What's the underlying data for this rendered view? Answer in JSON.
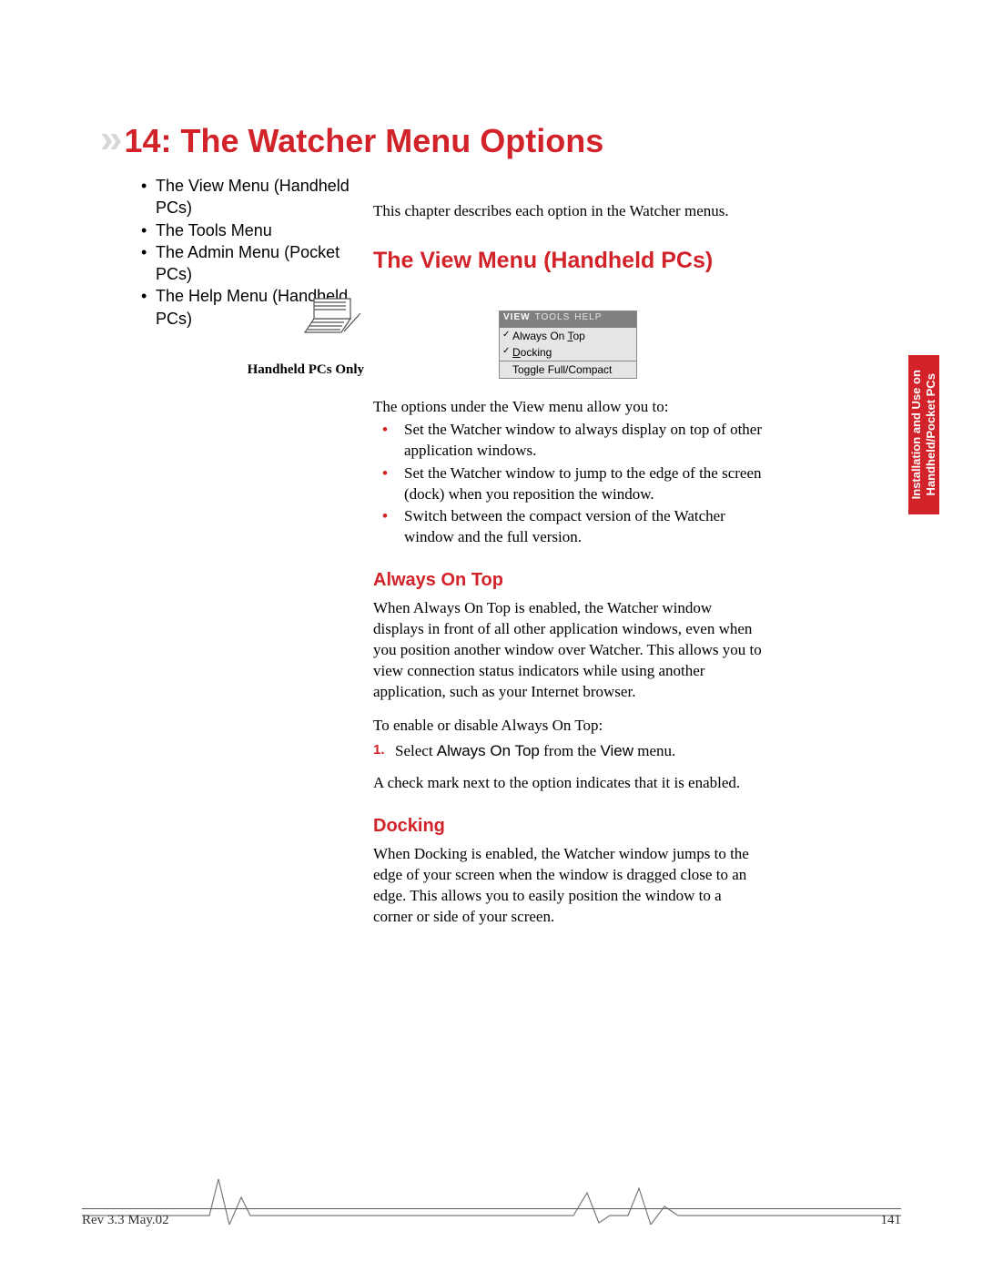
{
  "chapter": {
    "number": "14",
    "title": "The Watcher Menu Options"
  },
  "toc": [
    "The View Menu (Handheld PCs)",
    "The Tools Menu",
    "The Admin Menu (Pocket PCs)",
    "The Help Menu (Handheld PCs)"
  ],
  "intro": "This chapter describes each option in the Watcher menus.",
  "section1": {
    "heading": "The View Menu (Handheld PCs)",
    "side_note": "Handheld PCs Only",
    "menu": {
      "bar": [
        "VIEW",
        "TOOLS",
        "HELP"
      ],
      "items": [
        {
          "label": "Always On Top",
          "underline_index": 10,
          "checked": true
        },
        {
          "label": "Docking",
          "underline_index": 0,
          "checked": true
        },
        {
          "label": "Toggle Full/Compact",
          "underline_index": -1,
          "checked": false,
          "separator": true
        }
      ]
    },
    "lead": "The options under the View menu allow you to:",
    "bullets": [
      "Set the Watcher window to always display on top of other application windows.",
      "Set the Watcher window to jump to the edge of the screen (dock) when you reposition the window.",
      "Switch between the compact version of the Watcher window and the full version."
    ]
  },
  "always_on_top": {
    "heading": "Always On Top",
    "p1": "When Always On Top is enabled, the Watcher window displays in front of all other application windows, even when you position another window over Watcher. This allows you to view connection status indicators while using another application, such as your Internet browser.",
    "p2": "To enable or disable Always On Top:",
    "step1_prefix": "Select ",
    "step1_ui1": "Always On Top",
    "step1_mid": " from the ",
    "step1_ui2": "View",
    "step1_suffix": " menu.",
    "p3": "A check mark next to the option indicates that it is enabled."
  },
  "docking": {
    "heading": "Docking",
    "p1": "When Docking is enabled, the Watcher window jumps to the edge of your screen when the window is dragged close to an edge. This allows you to easily position the window to a corner or side of your screen."
  },
  "side_tab": {
    "line1": "Installation and Use on",
    "line2": "Handheld/Pocket PCs"
  },
  "footer": {
    "left": "Rev 3.3  May.02",
    "right": "141"
  }
}
